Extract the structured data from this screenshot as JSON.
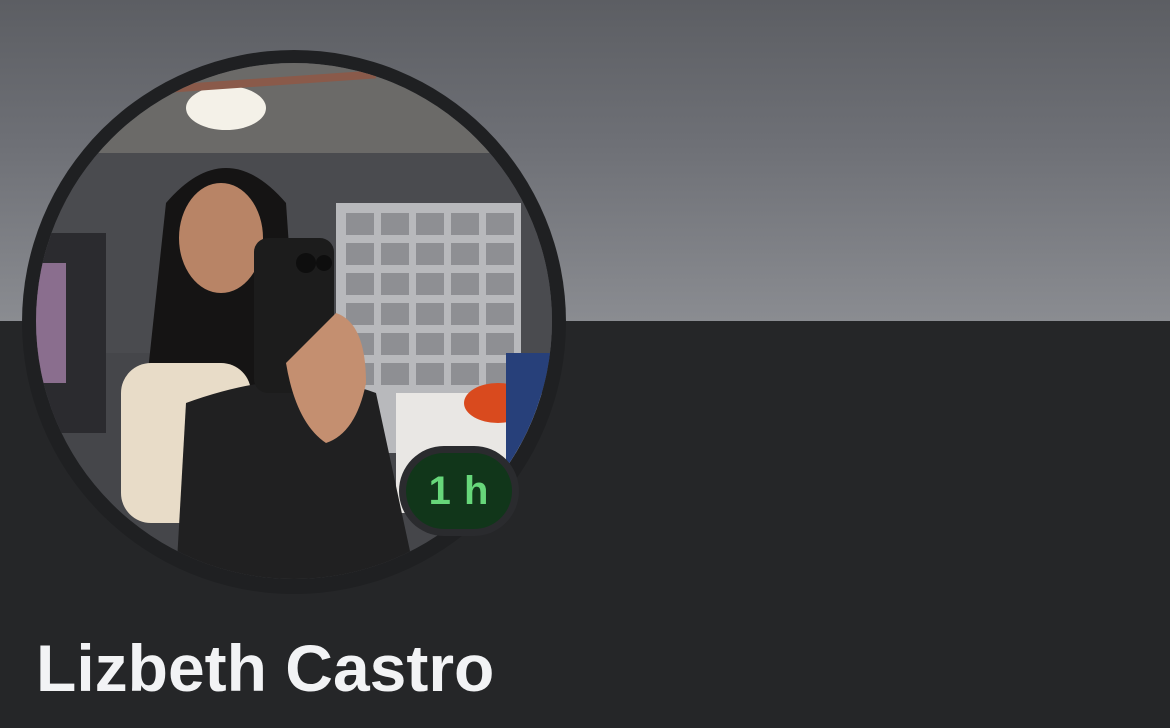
{
  "profile": {
    "name": "Lizbeth Castro",
    "active_badge": "1 h"
  },
  "colors": {
    "cover_top": "#5c5e63",
    "cover_bottom": "#8a8c91",
    "background": "#252628",
    "badge_bg": "#11361a",
    "badge_text": "#67d77a",
    "name_text": "#f2f3f5"
  },
  "icons": {
    "avatar": "profile-photo"
  }
}
